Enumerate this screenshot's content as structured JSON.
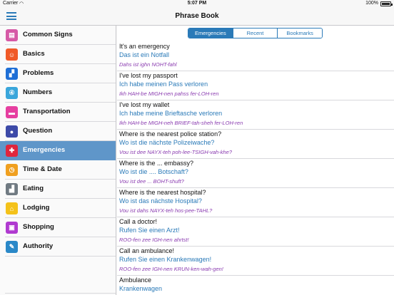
{
  "status_bar": {
    "carrier": "Carrier",
    "wifi": "wifi-icon",
    "time": "5:07 PM",
    "battery": "100%"
  },
  "navbar": {
    "title": "Phrase Book",
    "menu_icon": "hamburger-menu-icon"
  },
  "colors": {
    "accent": "#2a7ab8",
    "selected_row": "#5f96c9",
    "pronunciation": "#8a3bb0"
  },
  "sidebar": {
    "items": [
      {
        "label": "Common Signs",
        "icon": "sign-icon",
        "color": "#d65aa6",
        "glyph": "▤"
      },
      {
        "label": "Basics",
        "icon": "face-icon",
        "color": "#f05a28",
        "glyph": "☺"
      },
      {
        "label": "Problems",
        "icon": "problems-icon",
        "color": "#1f6fd6",
        "glyph": "▞"
      },
      {
        "label": "Numbers",
        "icon": "numbers-icon",
        "color": "#3aa6db",
        "glyph": "④"
      },
      {
        "label": "Transportation",
        "icon": "bus-icon",
        "color": "#e63fa0",
        "glyph": "▬"
      },
      {
        "label": "Question",
        "icon": "person-icon",
        "color": "#3d4aa8",
        "glyph": "●"
      },
      {
        "label": "Emergencies",
        "icon": "ambulance-icon",
        "color": "#e0263d",
        "glyph": "✚"
      },
      {
        "label": "Time & Date",
        "icon": "clock-icon",
        "color": "#f0a020",
        "glyph": "◷"
      },
      {
        "label": "Eating",
        "icon": "eating-icon",
        "color": "#707a82",
        "glyph": "▟"
      },
      {
        "label": "Lodging",
        "icon": "house-icon",
        "color": "#f4c21a",
        "glyph": "⌂"
      },
      {
        "label": "Shopping",
        "icon": "cart-icon",
        "color": "#b03ad0",
        "glyph": "▣"
      },
      {
        "label": "Authority",
        "icon": "pen-icon",
        "color": "#2a88c8",
        "glyph": "✎"
      }
    ],
    "selected": "Emergencies"
  },
  "segments": [
    {
      "label": "Emergencies",
      "active": true
    },
    {
      "label": "Recent",
      "active": false
    },
    {
      "label": "Bookmarks",
      "active": false
    }
  ],
  "phrases": [
    {
      "en": "It's an emergency",
      "de": "Das ist ein Notfall",
      "pron": "Dahs ist ighn NOHT-fahl"
    },
    {
      "en": "I've lost my passport",
      "de": "Ich habe meinen Pass verloren",
      "pron": "Ikh HAH-be MIGH-nen pahss fer-LOH-ren"
    },
    {
      "en": "I've lost my wallet",
      "de": "Ich habe meine Brieftasche verloren",
      "pron": "Ikh HAH-be MIGH-neh BRIEF-tah-sheh fer-LOH-ren"
    },
    {
      "en": "Where is the nearest police station?",
      "de": "Wo ist die nächste Polizeiwache?",
      "pron": "Vou ist dee NAYX-teh poh-lee-TSIGH-vah-khe?"
    },
    {
      "en": "Where is the ... embassy?",
      "de": "Wo ist die .... Botschaft?",
      "pron": "Vou ist dee ... BOHT-shuft?"
    },
    {
      "en": "Where is the nearest hospital?",
      "de": "Wo ist das nächste Hospital?",
      "pron": "Vou ist dahs NAYX-teh hos-pee-TAHL?"
    },
    {
      "en": "Call a doctor!",
      "de": "Rufen Sie einen Arzt!",
      "pron": "ROO-fen zee IGH-nen ahrtst!"
    },
    {
      "en": "Call an ambulance!",
      "de": "Rufen Sie einen Krankenwagen!",
      "pron": "ROO-fen zee IGH-nen KRUN-ken-wah-gen!"
    },
    {
      "en": "Ambulance",
      "de": "Krankenwagen",
      "pron": ""
    }
  ]
}
